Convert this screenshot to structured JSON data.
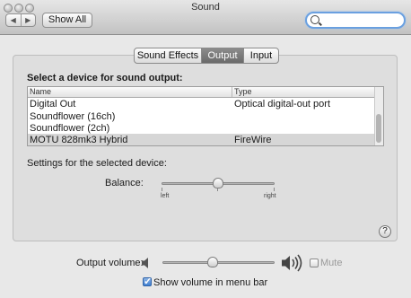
{
  "window": {
    "title": "Sound"
  },
  "toolbar": {
    "back": "◀",
    "forward": "▶",
    "show_all": "Show All",
    "search_value": ""
  },
  "tabs": [
    {
      "label": "Sound Effects",
      "active": false
    },
    {
      "label": "Output",
      "active": true
    },
    {
      "label": "Input",
      "active": false
    }
  ],
  "output": {
    "heading": "Select a device for sound output:",
    "columns": [
      "Name",
      "Type"
    ],
    "devices": [
      {
        "name": "Digital Out",
        "type": "Optical digital-out port",
        "selected": false
      },
      {
        "name": "Soundflower (16ch)",
        "type": "",
        "selected": false
      },
      {
        "name": "Soundflower (2ch)",
        "type": "",
        "selected": false
      },
      {
        "name": "MOTU 828mk3 Hybrid",
        "type": "FireWire",
        "selected": true
      }
    ],
    "settings_label": "Settings for the selected device:",
    "balance": {
      "label": "Balance:",
      "left": "left",
      "right": "right",
      "value": 0.5
    }
  },
  "footer": {
    "volume_label": "Output volume:",
    "volume_value": 0.45,
    "mute_label": "Mute",
    "mute_checked": false,
    "show_volume_label": "Show volume in menu bar",
    "show_volume_checked": true
  }
}
